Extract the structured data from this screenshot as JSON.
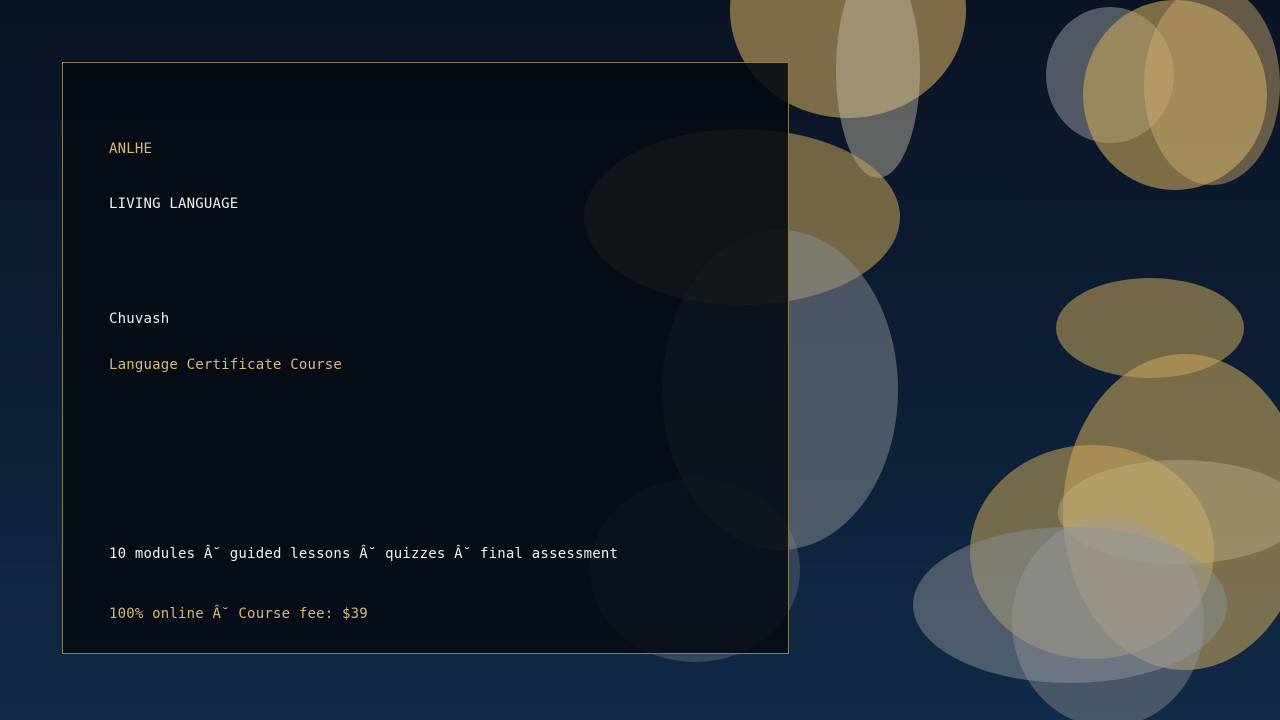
{
  "card": {
    "brand": "ANLHE",
    "tagline": "LIVING LANGUAGE",
    "language": "Chuvash",
    "course_title": "Language Certificate Course",
    "details": "10 modules Â˘ guided lessons Â˘ quizzes Â˘ final assessment",
    "pricing": "100% online Â˘ Course fee: $39"
  },
  "colors": {
    "background_top": "#0a1424",
    "background_bottom": "#112a48",
    "accent_gold": "#d8b87a",
    "card_border": "#8c7a52",
    "bokeh_gold": "#c9a65a",
    "bokeh_grey": "#8a8f96"
  }
}
